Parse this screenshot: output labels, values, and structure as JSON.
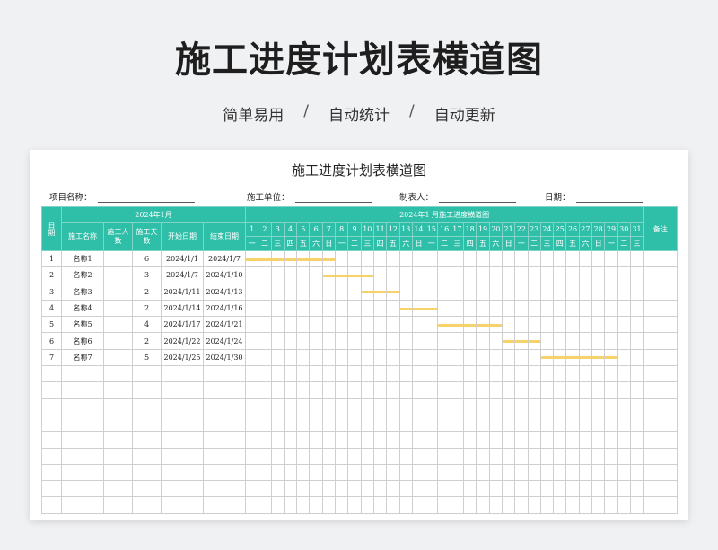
{
  "hero": {
    "title": "施工进度计划表横道图",
    "tags": [
      "简单易用",
      "自动统计",
      "自动更新"
    ],
    "separator": "/"
  },
  "sheet": {
    "title": "施工进度计划表横道图",
    "meta": {
      "project_label": "项目名称：",
      "unit_label": "施工单位：",
      "maker_label": "制表人：",
      "date_label": "日期："
    },
    "header": {
      "period": "日期",
      "month_group": "2024年1月",
      "gantt_group": "2024年1 月施工进度横道图",
      "name": "施工名称",
      "workers": "施工人数",
      "days": "施工天数",
      "start": "开始日期",
      "end": "结束日期",
      "remark": "备注"
    },
    "days": [
      "1",
      "2",
      "3",
      "4",
      "5",
      "6",
      "7",
      "8",
      "9",
      "10",
      "11",
      "12",
      "13",
      "14",
      "15",
      "16",
      "17",
      "18",
      "19",
      "20",
      "21",
      "22",
      "23",
      "24",
      "25",
      "26",
      "27",
      "28",
      "29",
      "30",
      "31"
    ],
    "weekdays": [
      "一",
      "二",
      "三",
      "四",
      "五",
      "六",
      "日",
      "一",
      "二",
      "三",
      "四",
      "五",
      "六",
      "日",
      "一",
      "二",
      "三",
      "四",
      "五",
      "六",
      "日",
      "一",
      "二",
      "三",
      "四",
      "五",
      "六",
      "日",
      "一",
      "二",
      "三"
    ],
    "rows": [
      {
        "no": "1",
        "name": "名称1",
        "workers": "",
        "days": "6",
        "start": "2024/1/1",
        "end": "2024/1/7",
        "bar_start_day": 1,
        "bar_end_day": 7
      },
      {
        "no": "2",
        "name": "名称2",
        "workers": "",
        "days": "3",
        "start": "2024/1/7",
        "end": "2024/1/10",
        "bar_start_day": 7,
        "bar_end_day": 10
      },
      {
        "no": "3",
        "name": "名称3",
        "workers": "",
        "days": "2",
        "start": "2024/1/11",
        "end": "2024/1/13",
        "bar_start_day": 10,
        "bar_end_day": 12
      },
      {
        "no": "4",
        "name": "名称4",
        "workers": "",
        "days": "2",
        "start": "2024/1/14",
        "end": "2024/1/16",
        "bar_start_day": 13,
        "bar_end_day": 15
      },
      {
        "no": "5",
        "name": "名称5",
        "workers": "",
        "days": "4",
        "start": "2024/1/17",
        "end": "2024/1/21",
        "bar_start_day": 16,
        "bar_end_day": 20
      },
      {
        "no": "6",
        "name": "名称6",
        "workers": "",
        "days": "2",
        "start": "2024/1/22",
        "end": "2024/1/24",
        "bar_start_day": 21,
        "bar_end_day": 23
      },
      {
        "no": "7",
        "name": "名称7",
        "workers": "",
        "days": "5",
        "start": "2024/1/25",
        "end": "2024/1/30",
        "bar_start_day": 24,
        "bar_end_day": 29
      }
    ],
    "bar_color": "#f5d36a",
    "header_color": "#2fbfa8"
  }
}
